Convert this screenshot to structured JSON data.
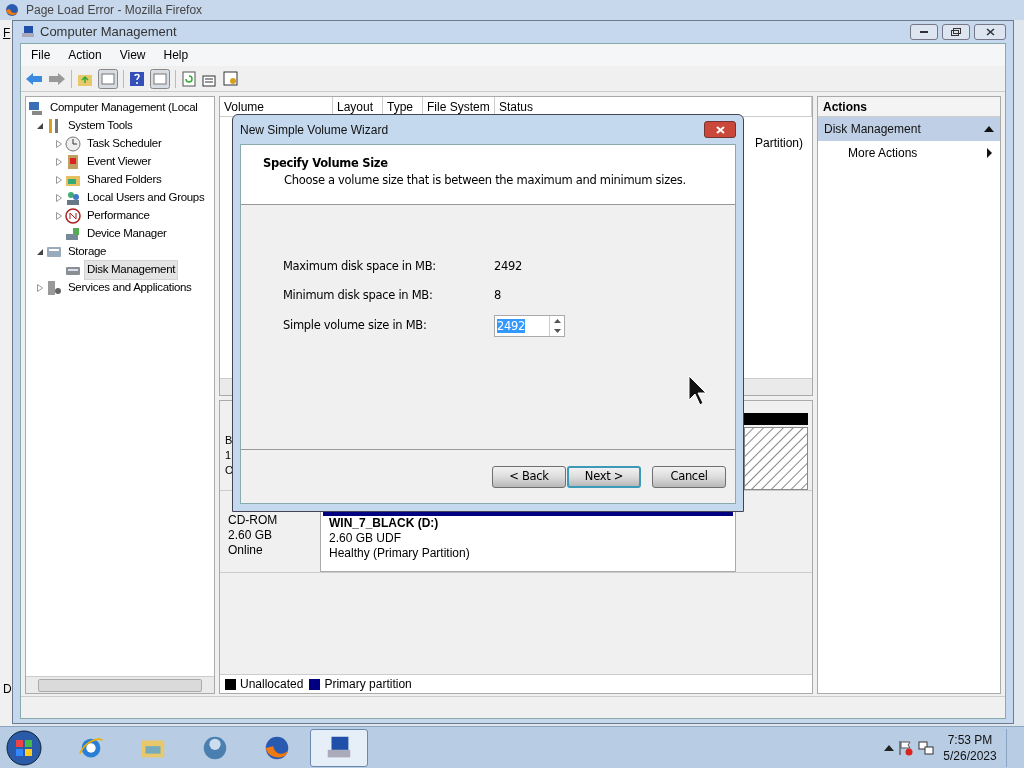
{
  "background_window": {
    "title": "Page Load Error - Mozilla Firefox",
    "menu_fragment": "F",
    "status_fragment": "D"
  },
  "window": {
    "title": "Computer Management"
  },
  "menu": [
    "File",
    "Action",
    "View",
    "Help"
  ],
  "tree": [
    {
      "label": "Computer Management (Local",
      "selected": false,
      "children": [
        {
          "label": "System Tools",
          "expanded": true,
          "selected": false,
          "children": [
            {
              "label": "Task Scheduler",
              "expanded": false,
              "selected": false
            },
            {
              "label": "Event Viewer",
              "expanded": false,
              "selected": false
            },
            {
              "label": "Shared Folders",
              "expanded": false,
              "selected": false
            },
            {
              "label": "Local Users and Groups",
              "expanded": false,
              "selected": false
            },
            {
              "label": "Performance",
              "expanded": false,
              "selected": false
            },
            {
              "label": "Device Manager",
              "selected": false
            }
          ]
        },
        {
          "label": "Storage",
          "expanded": true,
          "selected": false,
          "children": [
            {
              "label": "Disk Management",
              "selected": true
            }
          ]
        },
        {
          "label": "Services and Applications",
          "expanded": false,
          "selected": false
        }
      ]
    }
  ],
  "volume_list": {
    "columns": [
      "Volume",
      "Layout",
      "Type",
      "File System",
      "Status"
    ],
    "status_fragment": "Partition)"
  },
  "disks": [
    {
      "kind": "basic",
      "fragments": [
        "B",
        "1",
        "O"
      ]
    },
    {
      "kind": "cdrom",
      "lines": [
        "CD-ROM",
        "2.60 GB",
        "Online"
      ],
      "volume": {
        "name": "WIN_7_BLACK  (D:)",
        "lines": [
          "2.60 GB UDF",
          "Healthy (Primary Partition)"
        ]
      }
    }
  ],
  "legend": [
    {
      "label": "Unallocated",
      "color": "#000000"
    },
    {
      "label": "Primary partition",
      "color": "#000080"
    }
  ],
  "actions": {
    "title": "Actions",
    "section": "Disk Management",
    "items": [
      "More Actions"
    ]
  },
  "dialog": {
    "title": "New Simple Volume Wizard",
    "heading": "Specify Volume Size",
    "subtitle": "Choose a volume size that is between the maximum and minimum sizes.",
    "facts": [
      {
        "label": "Maximum disk space in MB:",
        "value": "2492"
      },
      {
        "label": "Minimum disk space in MB:",
        "value": "8"
      }
    ],
    "size_field": {
      "label": "Simple volume size in MB:",
      "value": "2492"
    },
    "buttons": [
      {
        "label": "< Back",
        "default": false
      },
      {
        "label": "Next >",
        "default": true
      },
      {
        "label": "Cancel",
        "default": false
      }
    ]
  },
  "taskbar": {
    "apps": [
      {
        "kind": "browser-e",
        "active": false
      },
      {
        "kind": "folder",
        "active": false
      },
      {
        "kind": "media",
        "active": false
      },
      {
        "kind": "fox",
        "active": false
      },
      {
        "kind": "computer",
        "active": true
      }
    ],
    "clock": {
      "time": "7:53 PM",
      "date": "5/26/2023"
    }
  }
}
